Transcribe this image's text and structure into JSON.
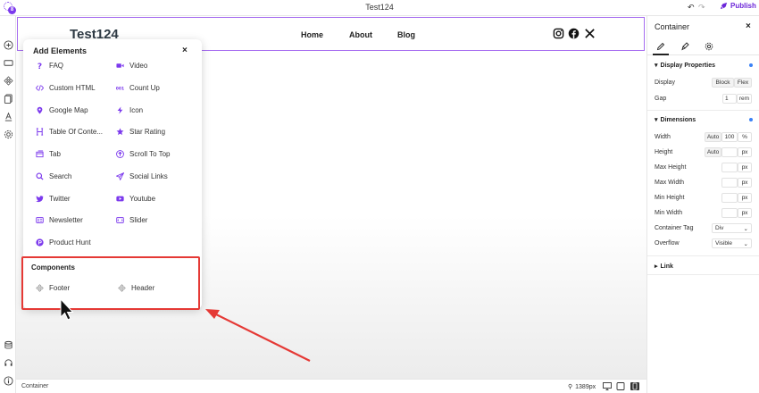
{
  "app": {
    "site_title": "Test124",
    "publish_label": "Publish",
    "logo_badge": "8"
  },
  "page": {
    "brand": "Test124",
    "nav": [
      "Home",
      "About",
      "Blog"
    ],
    "social_icons": [
      "instagram-icon",
      "facebook-icon",
      "x-icon"
    ]
  },
  "add_elements": {
    "title": "Add Elements",
    "close": "×",
    "items": [
      {
        "label": "FAQ",
        "icon": "question-icon"
      },
      {
        "label": "Video",
        "icon": "video-icon"
      },
      {
        "label": "Custom HTML",
        "icon": "code-icon"
      },
      {
        "label": "Count Up",
        "icon": "counter-icon"
      },
      {
        "label": "Google Map",
        "icon": "map-pin-icon"
      },
      {
        "label": "Icon",
        "icon": "bolt-icon"
      },
      {
        "label": "Table Of Conte...",
        "icon": "heading-icon"
      },
      {
        "label": "Star Rating",
        "icon": "star-icon"
      },
      {
        "label": "Tab",
        "icon": "tab-icon"
      },
      {
        "label": "Scroll To Top",
        "icon": "arrow-up-circle-icon"
      },
      {
        "label": "Search",
        "icon": "search-icon"
      },
      {
        "label": "Social Links",
        "icon": "send-icon"
      },
      {
        "label": "Twitter",
        "icon": "twitter-icon"
      },
      {
        "label": "Youtube",
        "icon": "youtube-icon"
      },
      {
        "label": "Newsletter",
        "icon": "newsletter-icon"
      },
      {
        "label": "Slider",
        "icon": "slider-icon"
      },
      {
        "label": "Product Hunt",
        "icon": "product-hunt-icon"
      }
    ],
    "components_title": "Components",
    "components": [
      {
        "label": "Footer",
        "icon": "component-icon"
      },
      {
        "label": "Header",
        "icon": "component-icon"
      }
    ]
  },
  "right_panel": {
    "title": "Container",
    "close": "×",
    "display_section": "Display Properties",
    "display_label": "Display",
    "display_options": [
      "Block",
      "Flex"
    ],
    "gap_label": "Gap",
    "gap_value": "1",
    "gap_unit": "rem",
    "dimensions_section": "Dimensions",
    "width_label": "Width",
    "width_auto": "Auto",
    "width_value": "100",
    "width_unit": "%",
    "height_label": "Height",
    "height_auto": "Auto",
    "height_unit": "px",
    "max_height_label": "Max Height",
    "max_height_unit": "px",
    "max_width_label": "Max Width",
    "max_width_unit": "px",
    "min_height_label": "Min Height",
    "min_height_unit": "px",
    "min_width_label": "Min Width",
    "min_width_unit": "px",
    "container_tag_label": "Container Tag",
    "container_tag_value": "Div",
    "overflow_label": "Overflow",
    "overflow_value": "Visible",
    "link_section": "Link"
  },
  "status": {
    "left": "Container",
    "zoom": "1389px"
  },
  "colors": {
    "accent": "#7c3aed",
    "highlight": "#e53935",
    "selection": "#a66cf0"
  }
}
